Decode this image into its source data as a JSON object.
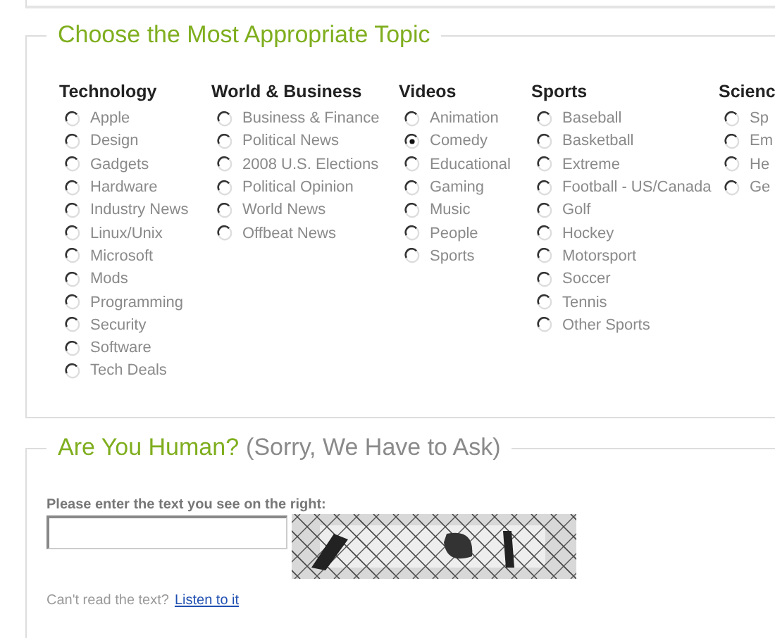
{
  "topic_section": {
    "title": "Choose the Most Appropriate Topic",
    "categories": [
      {
        "heading": "Technology",
        "options": [
          {
            "label": "Apple",
            "selected": false
          },
          {
            "label": "Design",
            "selected": false
          },
          {
            "label": "Gadgets",
            "selected": false
          },
          {
            "label": "Hardware",
            "selected": false
          },
          {
            "label": "Industry News",
            "selected": false
          },
          {
            "label": "Linux/Unix",
            "selected": false
          },
          {
            "label": "Microsoft",
            "selected": false
          },
          {
            "label": "Mods",
            "selected": false
          },
          {
            "label": "Programming",
            "selected": false
          },
          {
            "label": "Security",
            "selected": false
          },
          {
            "label": "Software",
            "selected": false
          },
          {
            "label": "Tech Deals",
            "selected": false
          }
        ]
      },
      {
        "heading": "World & Business",
        "options": [
          {
            "label": "Business & Finance",
            "selected": false
          },
          {
            "label": "Political News",
            "selected": false
          },
          {
            "label": "2008 U.S. Elections",
            "selected": false
          },
          {
            "label": "Political Opinion",
            "selected": false
          },
          {
            "label": "World News",
            "selected": false
          },
          {
            "label": "Offbeat News",
            "selected": false
          }
        ]
      },
      {
        "heading": "Videos",
        "options": [
          {
            "label": "Animation",
            "selected": false
          },
          {
            "label": "Comedy",
            "selected": true
          },
          {
            "label": "Educational",
            "selected": false
          },
          {
            "label": "Gaming",
            "selected": false
          },
          {
            "label": "Music",
            "selected": false
          },
          {
            "label": "People",
            "selected": false
          },
          {
            "label": "Sports",
            "selected": false
          }
        ]
      },
      {
        "heading": "Sports",
        "options": [
          {
            "label": "Baseball",
            "selected": false
          },
          {
            "label": "Basketball",
            "selected": false
          },
          {
            "label": "Extreme",
            "selected": false
          },
          {
            "label": "Football - US/Canada",
            "selected": false
          },
          {
            "label": "Golf",
            "selected": false
          },
          {
            "label": "Hockey",
            "selected": false
          },
          {
            "label": "Motorsport",
            "selected": false
          },
          {
            "label": "Soccer",
            "selected": false
          },
          {
            "label": "Tennis",
            "selected": false
          },
          {
            "label": "Other Sports",
            "selected": false
          }
        ]
      },
      {
        "heading": "Scienc",
        "options": [
          {
            "label": "Sp",
            "selected": false
          },
          {
            "label": "Em",
            "selected": false
          },
          {
            "label": "He",
            "selected": false
          },
          {
            "label": "Ge",
            "selected": false
          }
        ]
      }
    ]
  },
  "human_section": {
    "title": "Are You Human?",
    "note": "(Sorry, We Have to Ask)",
    "prompt": "Please enter the text you see on the right:",
    "help_text": "Can't read the text?",
    "help_link": "Listen to it"
  }
}
